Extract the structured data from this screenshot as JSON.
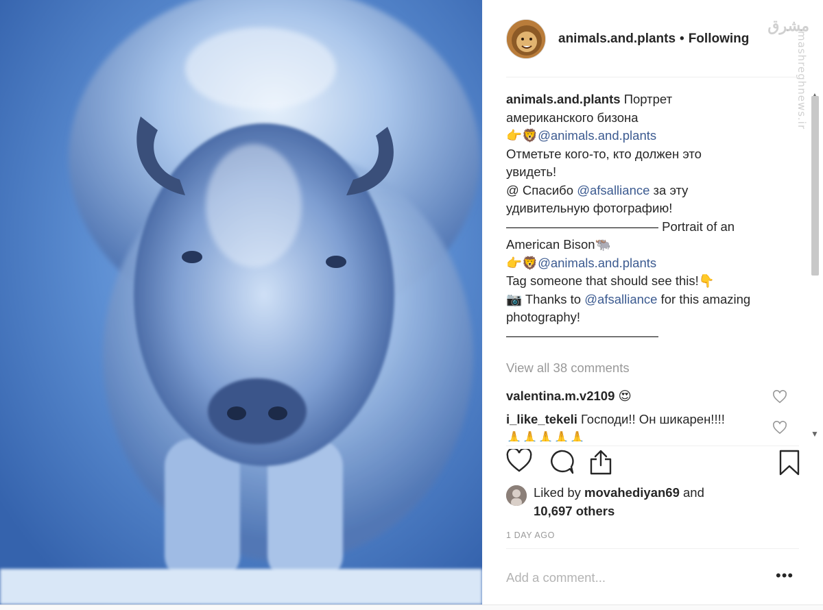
{
  "post": {
    "username": "animals.and.plants",
    "separator": "•",
    "follow_status": "Following",
    "avatar_icon": "lion-avatar-icon"
  },
  "watermark": {
    "logo": "مشرق",
    "url": "mashreghnews.ir"
  },
  "caption": {
    "user": "animals.and.plants",
    "lines": [
      "Портрет",
      "американского бизона",
      "@animals.and.plants",
      "Отметьте кого-то, кто должен это",
      "увидеть!",
      "@ Спасибо ",
      "@afsalliance",
      " за эту",
      "удивительную фотографию!",
      "———————————— Portrait of an",
      "American Bison",
      "@animals.and.plants",
      "Tag someone that should see this!",
      "Thanks to ",
      "@afsalliance",
      " for this amazing",
      "photography!",
      "————————————"
    ],
    "emoji": {
      "point_lion": "👉🦁",
      "bison": "🐃",
      "point_down": "👇",
      "camera": "📷"
    }
  },
  "view_all": "View all 38 comments",
  "comments": [
    {
      "user": "valentina.m.v2109",
      "text": "😍"
    },
    {
      "user": "i_like_tekeli",
      "text": "Господи!! Он шикарен!!!!",
      "text2": "🙏🙏🙏🙏🙏"
    }
  ],
  "likes": {
    "prefix": "Liked by ",
    "user": "movahediyan69",
    "suffix": " and",
    "others": "10,697 others"
  },
  "time": "1 DAY AGO",
  "add_comment_placeholder": "Add a comment...",
  "more_label": "•••",
  "icons": {
    "like": "heart-icon",
    "comment": "comment-icon",
    "share": "share-icon",
    "save": "bookmark-icon"
  },
  "colors": {
    "mention": "#3b5a90",
    "muted": "#999999",
    "text": "#262626"
  }
}
